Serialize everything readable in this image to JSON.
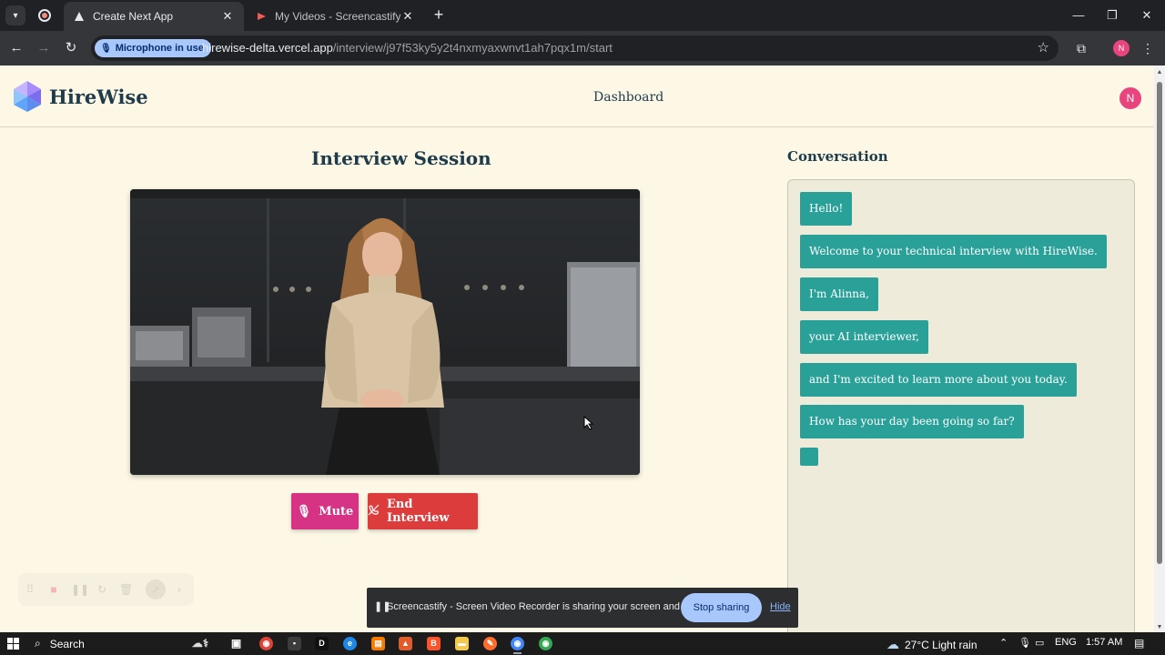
{
  "browser": {
    "tabs": [
      {
        "title": "Create Next App",
        "active": true
      },
      {
        "title": "My Videos - Screencastify",
        "active": false
      }
    ],
    "mic_chip": "Microphone in use",
    "url_host": "hirewise-delta.vercel.app",
    "url_path": "/interview/j97f53ky5y2t4nxmyaxwnvt1ah7pqx1m/start",
    "profile_initial": "N"
  },
  "site": {
    "brand": "HireWise",
    "nav_dashboard": "Dashboard",
    "avatar_initial": "N"
  },
  "session": {
    "title": "Interview Session",
    "mute_label": "Mute",
    "end_label": "End Interview"
  },
  "conversation": {
    "title": "Conversation",
    "messages": [
      "Hello!",
      "Welcome to your technical interview with HireWise.",
      "I'm Alinna,",
      "your AI interviewer,",
      "and I'm excited to learn more about you today.",
      "How has your day been going so far?"
    ]
  },
  "share_bar": {
    "text": "Screencastify - Screen Video Recorder is sharing your screen and audio.",
    "stop_label": "Stop sharing",
    "hide_label": "Hide"
  },
  "taskbar": {
    "search_label": "Search",
    "weather": "27°C  Light rain",
    "language": "ENG",
    "time": "1:57 AM"
  },
  "colors": {
    "page_bg": "#fdf8e6",
    "heading": "#1d3b4a",
    "message_bubble": "#2aa198",
    "mute_button": "#d63384",
    "end_button": "#dc3c3c",
    "avatar": "#e8457e"
  }
}
